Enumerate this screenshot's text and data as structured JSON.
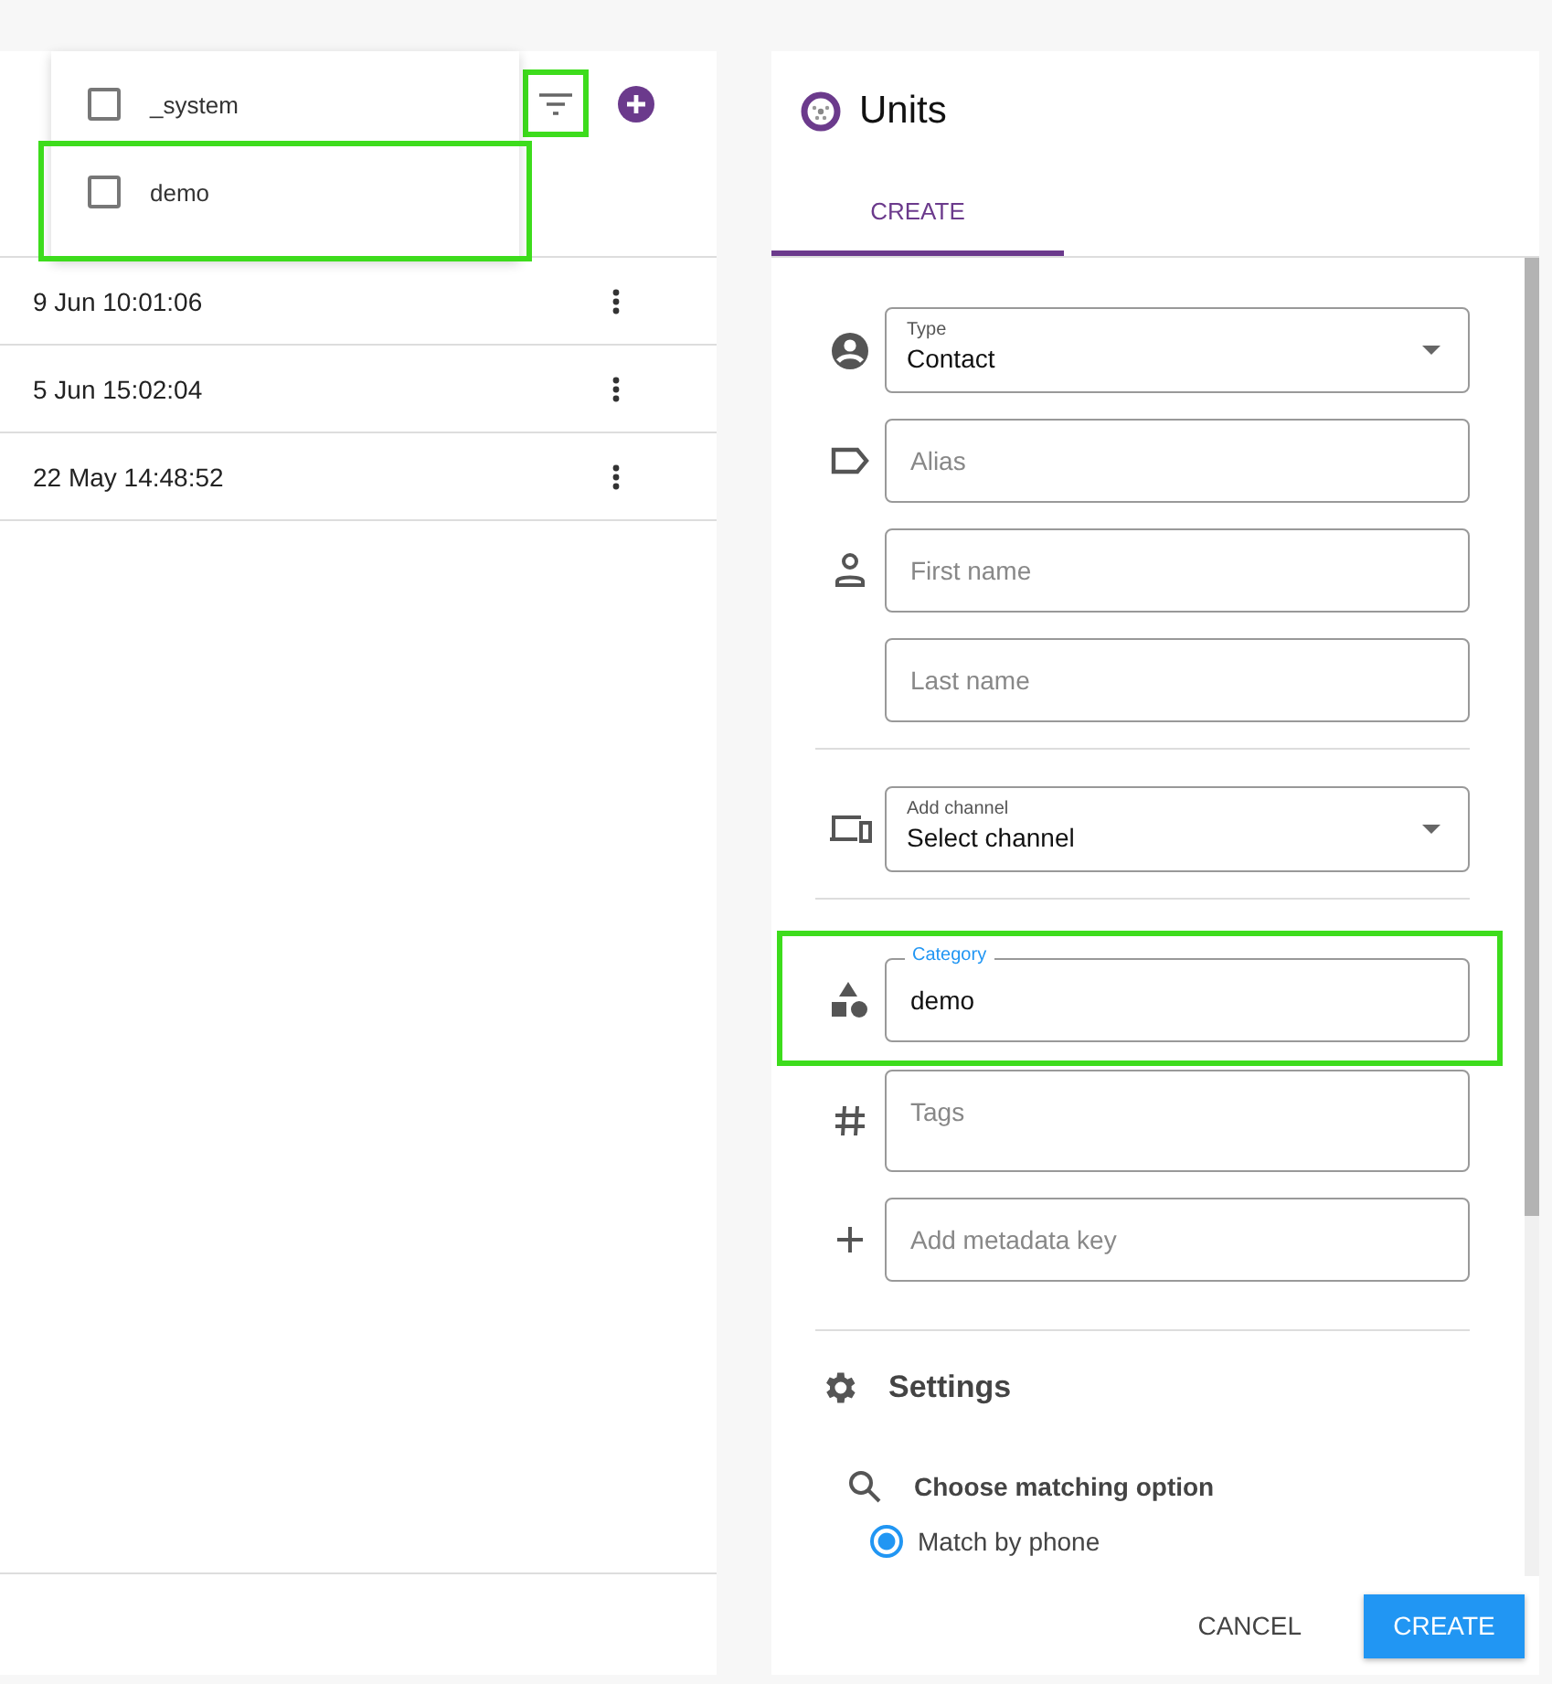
{
  "list": {
    "filter_button": {
      "highlighted": true
    },
    "filter_menu": [
      {
        "label": "_system",
        "checked": false,
        "highlighted": false
      },
      {
        "label": "demo",
        "checked": false,
        "highlighted": true
      }
    ],
    "rows": [
      {
        "date": "9 Jun 10:01:06"
      },
      {
        "date": "5 Jun 15:02:04"
      },
      {
        "date": "22 May 14:48:52"
      }
    ]
  },
  "panel": {
    "title": "Units",
    "tabs": [
      {
        "label": "CREATE",
        "selected": true
      }
    ],
    "sections": [
      [
        {
          "kind": "select",
          "label": "Type",
          "value": "Contact",
          "highlighted": false
        },
        {
          "kind": "input",
          "placeholder": "Alias",
          "highlighted": false
        },
        {
          "kind": "input",
          "placeholder": "First name",
          "highlighted": false
        },
        {
          "kind": "input",
          "placeholder": "Last name",
          "highlighted": false
        }
      ],
      [
        {
          "kind": "select",
          "label": "Add channel",
          "value": "Select channel",
          "highlighted": false
        }
      ],
      [
        {
          "kind": "input",
          "label": "Category",
          "value": "demo",
          "highlighted": true
        },
        {
          "kind": "textarea",
          "placeholder": "Tags",
          "highlighted": false
        },
        {
          "kind": "input",
          "placeholder": "Add metadata key",
          "highlighted": false
        }
      ]
    ],
    "settings": {
      "title": "Settings",
      "matching_title": "Choose matching option",
      "options": [
        {
          "label": "Match by phone",
          "selected": true
        }
      ]
    },
    "buttons": [
      {
        "label": "CANCEL",
        "kind": "text"
      },
      {
        "label": "CREATE",
        "kind": "primary"
      }
    ]
  }
}
